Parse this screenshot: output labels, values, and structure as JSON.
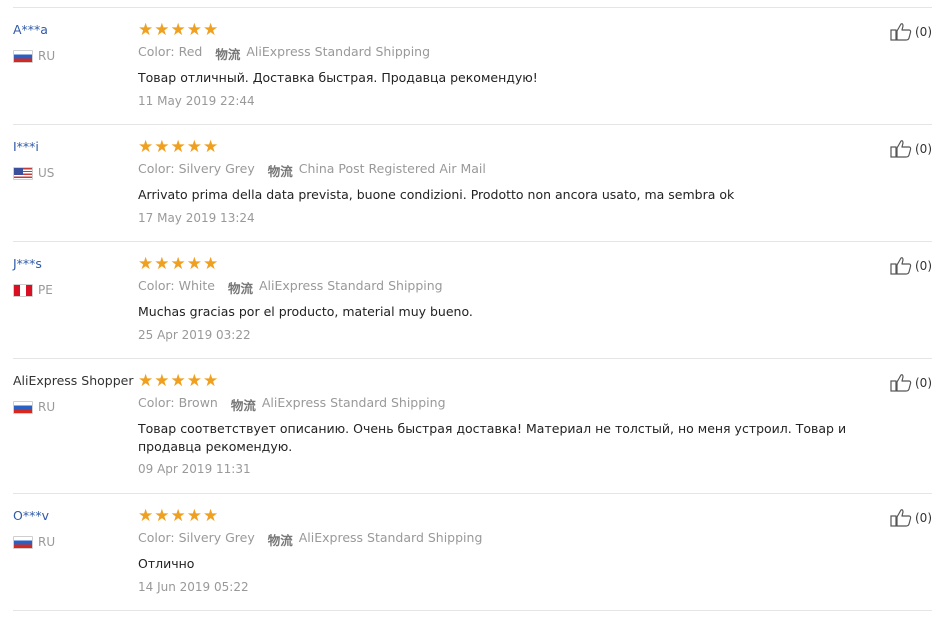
{
  "shipping_label": "物流",
  "reviews": [
    {
      "name": "A***a",
      "country": "RU",
      "flag": "ru",
      "rating": 5,
      "color": "Color: Red",
      "shipping": "AliExpress Standard Shipping",
      "text": "Товар отличный. Доставка быстрая. Продавца рекомендую!",
      "date": "11 May 2019 22:44",
      "helpful": "(0)"
    },
    {
      "name": "I***i",
      "country": "US",
      "flag": "us",
      "rating": 5,
      "color": "Color: Silvery Grey",
      "shipping": "China Post Registered Air Mail",
      "text": "Arrivato prima della data prevista, buone condizioni. Prodotto non ancora usato, ma sembra ok",
      "date": "17 May 2019 13:24",
      "helpful": "(0)"
    },
    {
      "name": "J***s",
      "country": "PE",
      "flag": "pe",
      "rating": 5,
      "color": "Color: White",
      "shipping": "AliExpress Standard Shipping",
      "text": "Muchas gracias por el producto, material muy bueno.",
      "date": "25 Apr 2019 03:22",
      "helpful": "(0)"
    },
    {
      "name": "AliExpress Shopper",
      "country": "RU",
      "flag": "ru",
      "rating": 5,
      "color": "Color: Brown",
      "shipping": "AliExpress Standard Shipping",
      "text": "Товар соответствует описанию. Очень быстрая доставка! Материал не толстый, но меня устроил. Товар и продавца рекомендую.",
      "date": "09 Apr 2019 11:31",
      "helpful": "(0)"
    },
    {
      "name": "O***v",
      "country": "RU",
      "flag": "ru",
      "rating": 5,
      "color": "Color: Silvery Grey",
      "shipping": "AliExpress Standard Shipping",
      "text": "Отлично",
      "date": "14 Jun 2019 05:22",
      "helpful": "(0)"
    }
  ]
}
